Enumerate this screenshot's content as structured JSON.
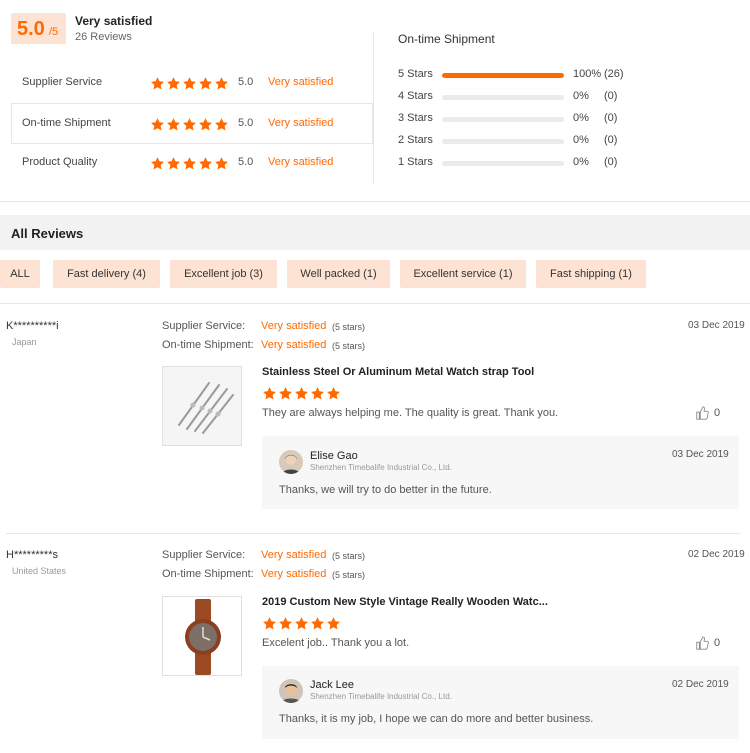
{
  "summary": {
    "score": "5.0",
    "score_max": "/5",
    "rating_text": "Very satisfied",
    "reviews_count": "26 Reviews",
    "categories": [
      {
        "label": "Supplier Service",
        "value": "5.0",
        "text": "Very satisfied"
      },
      {
        "label": "On-time Shipment",
        "value": "5.0",
        "text": "Very satisfied"
      },
      {
        "label": "Product Quality",
        "value": "5.0",
        "text": "Very satisfied"
      }
    ],
    "detail_title": "On-time Shipment",
    "breakdown": [
      {
        "label": "5 Stars",
        "percent": "100%",
        "count": "(26)",
        "fill": 1.0
      },
      {
        "label": "4 Stars",
        "percent": "0%",
        "count": "(0)",
        "fill": 0
      },
      {
        "label": "3 Stars",
        "percent": "0%",
        "count": "(0)",
        "fill": 0
      },
      {
        "label": "2 Stars",
        "percent": "0%",
        "count": "(0)",
        "fill": 0
      },
      {
        "label": "1 Stars",
        "percent": "0%",
        "count": "(0)",
        "fill": 0
      }
    ]
  },
  "all_reviews": {
    "title": "All Reviews",
    "filters": [
      "ALL",
      "Fast delivery (4)",
      "Excellent job (3)",
      "Well packed (1)",
      "Excellent service (1)",
      "Fast shipping (1)"
    ]
  },
  "reviews": [
    {
      "reviewer": "K**********i",
      "country": "Japan",
      "supplier_label": "Supplier Service:",
      "supplier_value": "Very satisfied",
      "supplier_stars": "(5 stars)",
      "shipment_label": "On-time Shipment:",
      "shipment_value": "Very satisfied",
      "shipment_stars": "(5 stars)",
      "date": "03 Dec 2019",
      "product_title": "Stainless Steel Or Aluminum Metal Watch strap Tool",
      "rating": 5,
      "text": "They are always helping me. The quality is great. Thank you.",
      "likes": "0",
      "reply": {
        "name": "Elise Gao",
        "company": "Shenzhen Timebalife Industrial Co., Ltd.",
        "date": "03 Dec 2019",
        "text": "Thanks, we will try to do better in the future."
      }
    },
    {
      "reviewer": "H*********s",
      "country": "United States",
      "supplier_label": "Supplier Service:",
      "supplier_value": "Very satisfied",
      "supplier_stars": "(5 stars)",
      "shipment_label": "On-time Shipment:",
      "shipment_value": "Very satisfied",
      "shipment_stars": "(5 stars)",
      "date": "02 Dec 2019",
      "product_title": "2019 Custom New Style Vintage Really Wooden Watc...",
      "rating": 5,
      "text": "Excelent job.. Thank you a lot.",
      "likes": "0",
      "reply": {
        "name": "Jack Lee",
        "company": "Shenzhen Timebalife Industrial Co., Ltd.",
        "date": "02 Dec 2019",
        "text": "Thanks, it is my job, I hope we can do more and better business."
      }
    }
  ],
  "colors": {
    "accent": "#ff6a00",
    "chip_bg": "#fde3d4",
    "section_bg": "#f2f2f2"
  }
}
